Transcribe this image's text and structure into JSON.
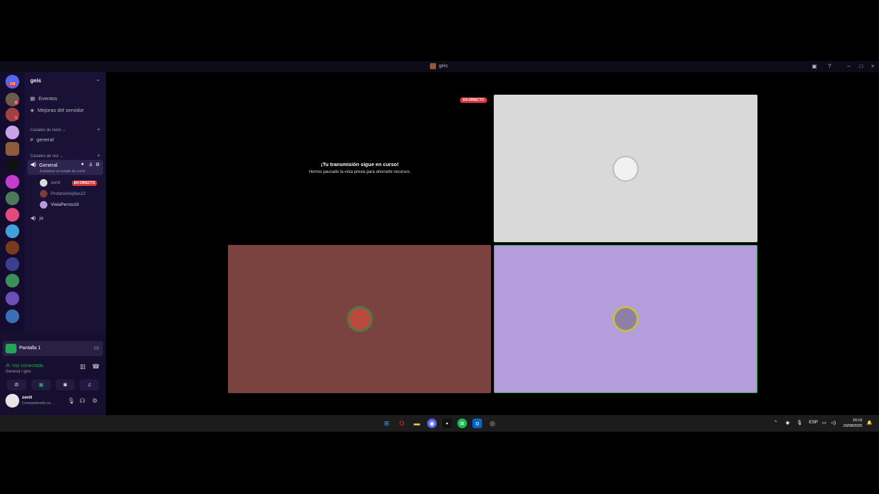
{
  "window": {
    "title": "geis"
  },
  "server": {
    "name": "geis"
  },
  "rail": {
    "badge_top": "208",
    "badge_2": "8",
    "badge_3": "1"
  },
  "nav": {
    "events": "Eventos",
    "boosts": "Mejoras del servidor"
  },
  "categories": {
    "text": "Canales de texto",
    "voice": "Canales de voz"
  },
  "channels": {
    "general_text": "general",
    "general_voice": "General",
    "voice_status": "Establece un estado de canal",
    "ja": "ja"
  },
  "members": [
    {
      "name": "zenit",
      "live": "EN DIRECTO",
      "color": "#d9d9d9"
    },
    {
      "name": "ProfanaViejitas22",
      "color": "#7a3d3a"
    },
    {
      "name": "ViolaPerros19",
      "color": "#b39ddb"
    }
  ],
  "screenshare": {
    "label": "Pantalla 1"
  },
  "voice": {
    "status": "Voz conectada",
    "location": "General / geis"
  },
  "user": {
    "name": "zenit",
    "status": "Compartiendo su ..."
  },
  "stage": {
    "paused_title": "¡Tu transmisión sigue en curso!",
    "paused_sub": "Hemos pausado la vista previa para ahorrarte recursos.",
    "live_tag": "EN DIRECTO",
    "tiles": [
      {
        "color": "#d9d9d9",
        "avatar": "#f1f1f1"
      },
      {
        "color": "#7a433f",
        "avatar": "#c0392b"
      },
      {
        "color": "#b39ddb",
        "avatar": "#8d7fa6"
      }
    ]
  },
  "taskbar": {
    "lang": "ESP",
    "time": "20:15",
    "date": "23/08/2025"
  },
  "colors": {
    "accent_green": "#23a559",
    "live_red": "#da373c"
  }
}
